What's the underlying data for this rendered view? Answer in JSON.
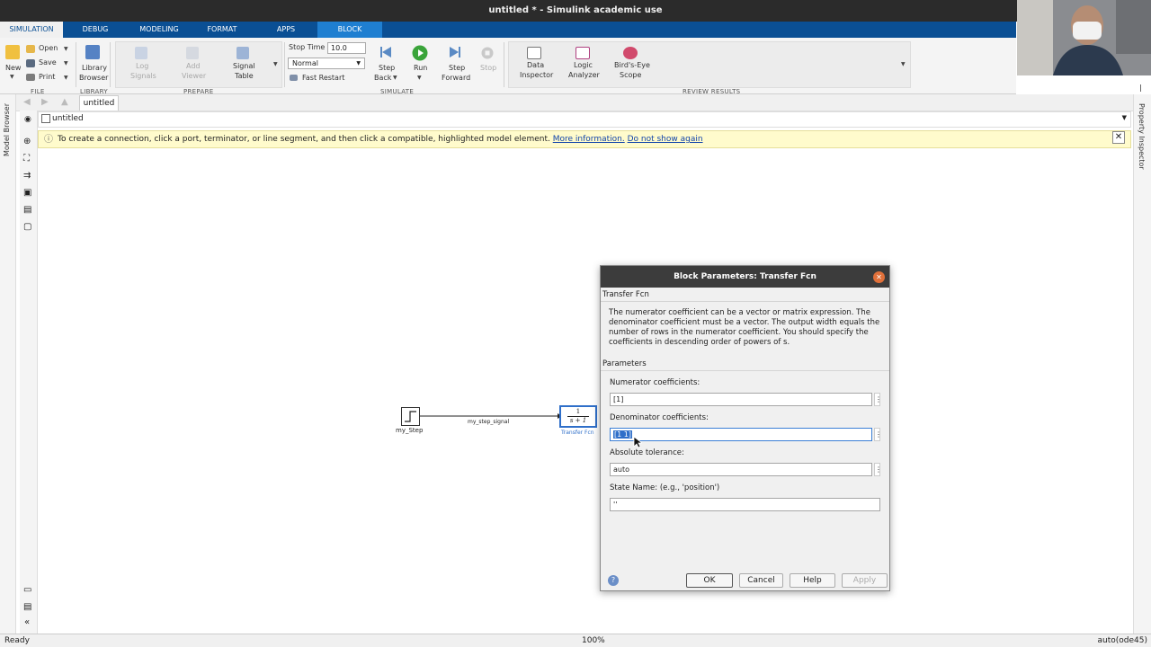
{
  "window": {
    "title": "untitled * - Simulink academic use"
  },
  "tabs": [
    {
      "label": "SIMULATION",
      "active": true
    },
    {
      "label": "DEBUG"
    },
    {
      "label": "MODELING"
    },
    {
      "label": "FORMAT"
    },
    {
      "label": "APPS"
    },
    {
      "label": "BLOCK"
    }
  ],
  "ribbon": {
    "file": {
      "new": "New",
      "open": "Open",
      "save": "Save",
      "print": "Print",
      "library_browser_1": "Library",
      "library_browser_2": "Browser",
      "section": "FILE",
      "library_section": "LIBRARY"
    },
    "prepare": {
      "log_signals_1": "Log",
      "log_signals_2": "Signals",
      "add_viewer_1": "Add",
      "add_viewer_2": "Viewer",
      "signal_table_1": "Signal",
      "signal_table_2": "Table",
      "section": "PREPARE"
    },
    "simulate": {
      "stop_time_label": "Stop Time",
      "stop_time_value": "10.0",
      "mode": "Normal",
      "fast_restart": "Fast Restart",
      "step_back_1": "Step",
      "step_back_2": "Back",
      "run": "Run",
      "step_forward_1": "Step",
      "step_forward_2": "Forward",
      "stop": "Stop",
      "section": "SIMULATE"
    },
    "review": {
      "data_inspector_1": "Data",
      "data_inspector_2": "Inspector",
      "logic_analyzer_1": "Logic",
      "logic_analyzer_2": "Analyzer",
      "birds_eye_1": "Bird's-Eye",
      "birds_eye_2": "Scope",
      "section": "REVIEW RESULTS"
    }
  },
  "side": {
    "model_browser": "Model Browser",
    "property_inspector": "Property Inspector"
  },
  "model_tab": "untitled",
  "address": "untitled",
  "notice": {
    "text": "To create a connection, click a port, terminator, or line segment, and then click a compatible, highlighted model element.",
    "link1": "More information.",
    "link2": "Do not show again"
  },
  "diagram": {
    "step_block_label": "my_Step",
    "signal_label": "my_step_signal",
    "tf_block_label": "Transfer Fcn",
    "tf_numerator": "1",
    "tf_denominator": "s + 1"
  },
  "dialog": {
    "title": "Block Parameters: Transfer Fcn",
    "block_type": "Transfer Fcn",
    "description": "The numerator coefficient can be a vector or matrix expression. The denominator coefficient must be a vector. The output width equals the number of rows in the numerator coefficient. You should specify the coefficients in descending order of powers of s.",
    "params_header": "Parameters",
    "numerator_label": "Numerator coefficients:",
    "numerator_value": "[1]",
    "denominator_label": "Denominator coefficients:",
    "denominator_value": "[1 1]",
    "abs_tol_label": "Absolute tolerance:",
    "abs_tol_value": "auto",
    "state_name_label": "State Name: (e.g., 'position')",
    "state_name_value": "''",
    "ok": "OK",
    "cancel": "Cancel",
    "help": "Help",
    "apply": "Apply"
  },
  "status": {
    "left": "Ready",
    "zoom": "100%",
    "solver": "auto(ode45)"
  },
  "colors": {
    "tab_bar": "#0a4f94",
    "block_tab": "#1f7fd1",
    "selection": "#2f6fc9",
    "link": "#1144aa"
  }
}
